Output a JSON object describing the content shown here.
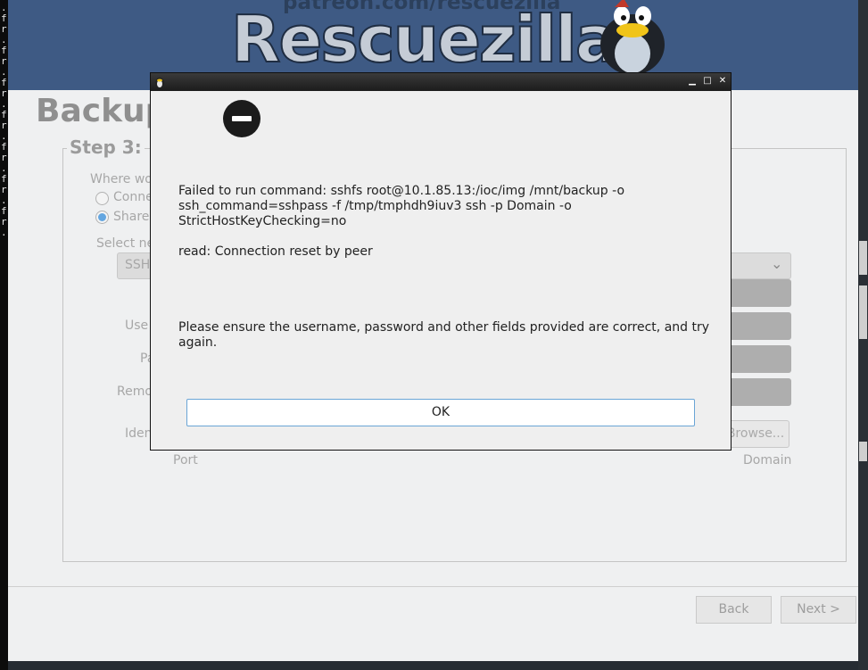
{
  "terminal_glyphs": [
    ".",
    "f",
    "r",
    ".",
    "f",
    "r",
    ".",
    "f",
    "r",
    ".",
    "f",
    "r",
    ".",
    "f",
    "r",
    ".",
    "f",
    "r",
    ".",
    "f",
    "r",
    "."
  ],
  "banner": {
    "url": "patreon.com/rescuezilla",
    "title": "Rescuezilla",
    "mascot": "penguin-mascot"
  },
  "page": {
    "title": "Backup",
    "step_title": "Step 3:",
    "where_label": "Where wo",
    "radio_1": "Conne",
    "radio_2": "Share",
    "select_label": "Select ne",
    "select_value": "SSH",
    "username_label": "Use",
    "password_label": "Pa",
    "remote_label": "Remo",
    "identity_label": "Iden",
    "browse_button": "Browse...",
    "port_label": "Port",
    "domain_label": "Domain",
    "back_button": "Back",
    "next_button": "Next >"
  },
  "dialog": {
    "icon": "error-icon",
    "message_1": "Failed to run command: sshfs root@10.1.85.13:/ioc/img /mnt/backup -o ssh_command=sshpass -f /tmp/tmphdh9iuv3 ssh -p Domain -o StrictHostKeyChecking=no",
    "message_2": "read: Connection reset by peer",
    "message_3": "Please ensure the username, password and other fields provided are correct, and try again.",
    "ok_button": "OK",
    "minimize": "▁",
    "maximize": "□",
    "close": "✕"
  },
  "colors": {
    "banner_bg": "#3e5a84",
    "window_bg": "#eff0f1",
    "dialog_titlebar": "#1c1c1c",
    "ok_border": "#6aa5d6"
  }
}
